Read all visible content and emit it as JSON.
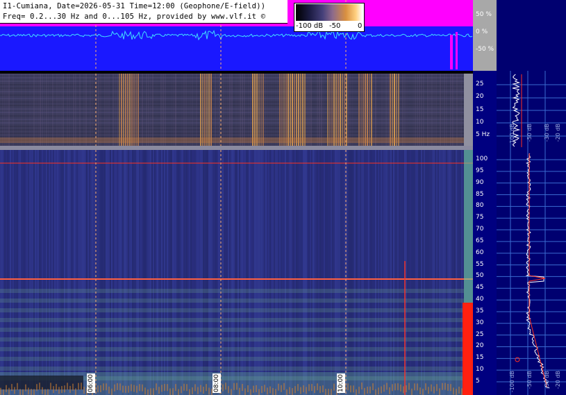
{
  "title": {
    "line1": "I1-Cumiana, Date=2026-05-31 Time=12:00 (Geophone/E-field))",
    "line2": "Freq= 0.2...30 Hz and 0...105 Hz, provided by www.vlf.it ©"
  },
  "colorbar": {
    "min_label": "-100 dB",
    "mid_label": "-50",
    "max_label": "0"
  },
  "amplitude_axis": [
    "50 %",
    "0 %",
    "-50 %"
  ],
  "low_freq_axis": [
    "25",
    "20",
    "15",
    "10",
    "5 Hz"
  ],
  "high_freq_axis": [
    "100",
    "95",
    "90",
    "85",
    "80",
    "75",
    "70",
    "65",
    "60",
    "55",
    "50",
    "45",
    "40",
    "35",
    "30",
    "25",
    "20",
    "15",
    "10",
    "5"
  ],
  "time_labels": [
    "06:00",
    "08:00",
    "10:00"
  ],
  "profile_top_labels": [
    "-100 dB",
    "-50 dB",
    "-30 dB",
    "-20 dB"
  ],
  "profile_bottom_labels": [
    "-100 dB",
    "-50 dB",
    "-30 dB",
    "-20 dB"
  ],
  "colors": {
    "wave_bg": "#1a18ff",
    "wave_clip": "#ff00ff",
    "trace": "#40e0ff",
    "spec_bg": "#2a2f80",
    "marker": "#ff3020",
    "axis_bg": "#000080"
  }
}
